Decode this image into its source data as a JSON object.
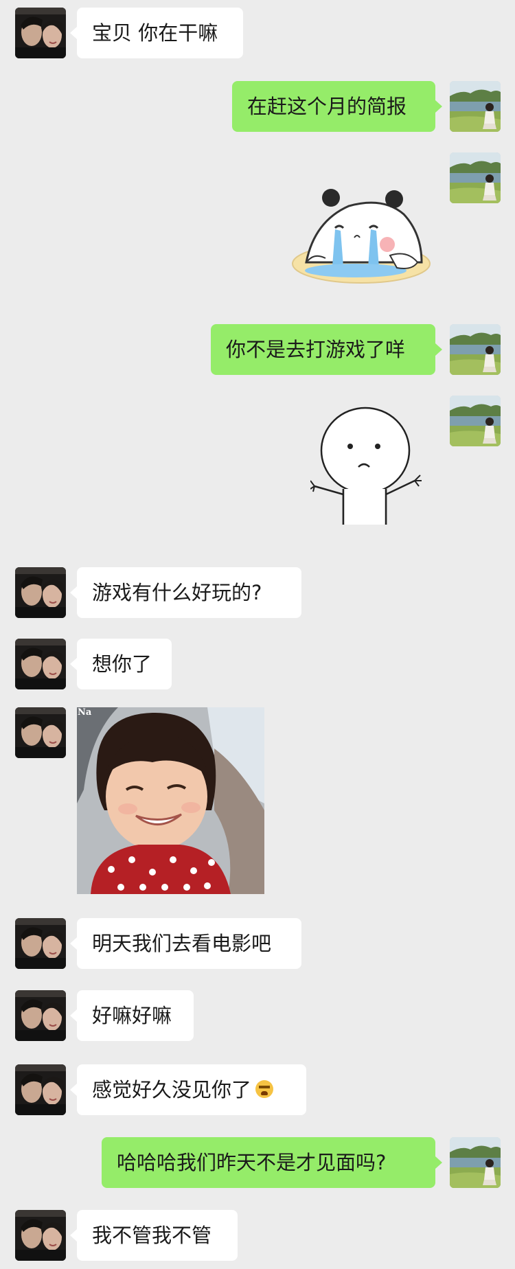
{
  "chat": {
    "messages": [
      {
        "side": "left",
        "type": "text",
        "text": "宝贝 你在干嘛"
      },
      {
        "side": "right",
        "type": "text",
        "text": "在赶这个月的简报"
      },
      {
        "side": "right",
        "type": "sticker",
        "sticker": "crying-panda-sticker"
      },
      {
        "side": "right",
        "type": "text",
        "text": "你不是去打游戏了咩"
      },
      {
        "side": "right",
        "type": "sticker",
        "sticker": "shrugging-stickman-sticker"
      },
      {
        "side": "left",
        "type": "text",
        "text": "游戏有什么好玩的?"
      },
      {
        "side": "left",
        "type": "text",
        "text": "想你了"
      },
      {
        "side": "left",
        "type": "image",
        "watermark": "Na"
      },
      {
        "side": "left",
        "type": "text",
        "text": "明天我们去看电影吧"
      },
      {
        "side": "left",
        "type": "text",
        "text": "好嘛好嘛"
      },
      {
        "side": "left",
        "type": "text",
        "text": "感觉好久没见你了",
        "emoji": "persevering-face-emoji"
      },
      {
        "side": "right",
        "type": "text",
        "text": "哈哈哈我们昨天不是才见面吗?"
      },
      {
        "side": "left",
        "type": "text",
        "text": "我不管我不管"
      }
    ]
  },
  "colors": {
    "background": "#ececec",
    "left_bubble": "#ffffff",
    "right_bubble": "#95ec69"
  }
}
